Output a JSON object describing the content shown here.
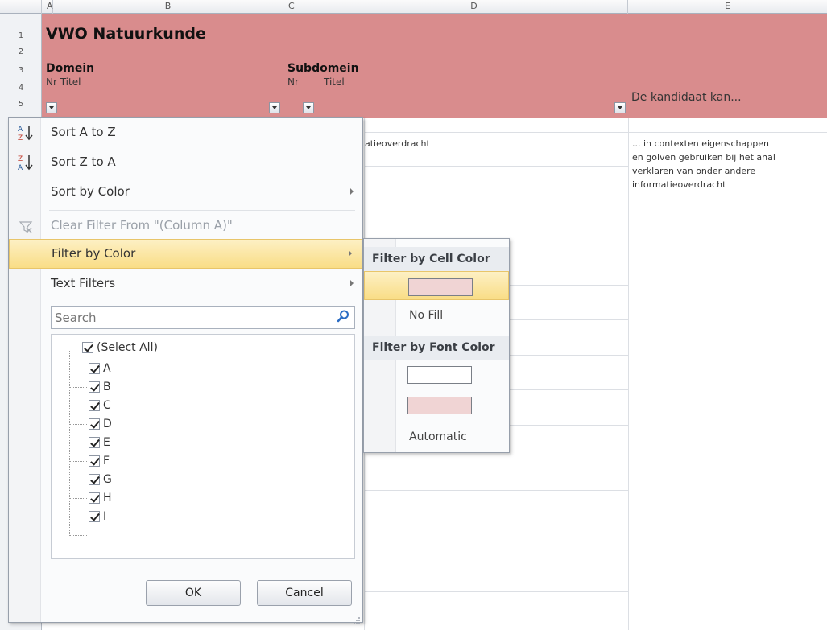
{
  "columns": [
    "A",
    "B",
    "C",
    "D",
    "E"
  ],
  "rows": [
    "1",
    "2",
    "3",
    "4",
    "5"
  ],
  "sheet": {
    "title": "VWO Natuurkunde",
    "domein_label": "Domein",
    "domein_sub": "Nr Titel",
    "subdomein_label": "Subdomein",
    "subdomein_nr": "Nr",
    "subdomein_titel": "Titel",
    "kandidaat_label": "De kandidaat kan...",
    "header_color": "#d98c8d",
    "cell_d6": "atieoverdracht",
    "cell_e6": [
      "... in contexten eigenschappen",
      "en golven gebruiken bij het anal",
      "verklaren van onder andere",
      "informatieoverdracht"
    ]
  },
  "filter_menu": {
    "items": [
      {
        "label": "Sort A to Z",
        "icon": "sort-az-icon"
      },
      {
        "label": "Sort Z to A",
        "icon": "sort-za-icon"
      },
      {
        "label": "Sort by Color",
        "submenu": true
      },
      {
        "label": "Clear Filter From \"(Column A)\"",
        "disabled": true,
        "icon": "clear-filter-icon"
      },
      {
        "label": "Filter by Color",
        "submenu": true,
        "active": true
      },
      {
        "label": "Text Filters",
        "submenu": true
      }
    ],
    "search_placeholder": "Search",
    "checklist": [
      "(Select All)",
      "A",
      "B",
      "C",
      "D",
      "E",
      "F",
      "G",
      "H",
      "I"
    ],
    "ok_label": "OK",
    "cancel_label": "Cancel"
  },
  "color_submenu": {
    "cell_color_heading": "Filter by Cell Color",
    "no_fill_label": "No Fill",
    "font_color_heading": "Filter by Font Color",
    "automatic_label": "Automatic",
    "cell_swatch_color": "#f0d4d4",
    "font_swatches": [
      "#ffffff",
      "#f0d4d4"
    ],
    "highlight_color": "#f9dd86"
  }
}
